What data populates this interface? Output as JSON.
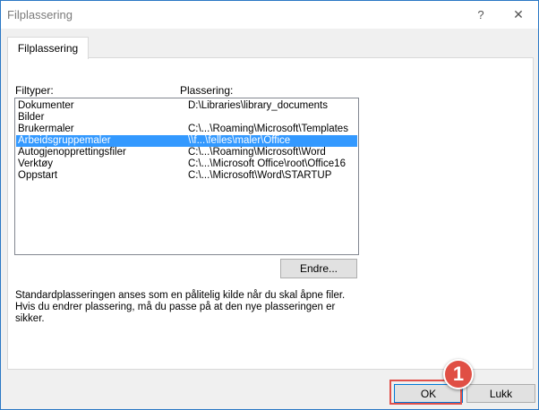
{
  "window": {
    "title": "Filplassering",
    "help_glyph": "?",
    "close_glyph": "✕"
  },
  "tab": {
    "label": "Filplassering"
  },
  "list": {
    "header_type": "Filtyper:",
    "header_location": "Plassering:",
    "selected_index": 3,
    "rows": [
      {
        "type": "Dokumenter",
        "location": "D:\\Libraries\\library_documents"
      },
      {
        "type": "Bilder",
        "location": ""
      },
      {
        "type": "Brukermaler",
        "location": "C:\\...\\Roaming\\Microsoft\\Templates"
      },
      {
        "type": "Arbeidsgruppemaler",
        "location": "\\\\f...\\felles\\maler\\Office"
      },
      {
        "type": "Autogjenopprettingsfiler",
        "location": "C:\\...\\Roaming\\Microsoft\\Word"
      },
      {
        "type": "Verktøy",
        "location": "C:\\...\\Microsoft Office\\root\\Office16"
      },
      {
        "type": "Oppstart",
        "location": "C:\\...\\Microsoft\\Word\\STARTUP"
      }
    ]
  },
  "change_button": {
    "label": "Endre..."
  },
  "info_text": "Standardplasseringen anses som en pålitelig kilde når du skal åpne filer. Hvis du endrer plassering, må du passe på at den nye plasseringen er sikker.",
  "buttons": {
    "ok": "OK",
    "close": "Lukk"
  },
  "annotation": {
    "step_number": "1",
    "color": "#e04f45"
  },
  "colors": {
    "selection": "#3399ff",
    "window_border": "#2b78c5"
  }
}
